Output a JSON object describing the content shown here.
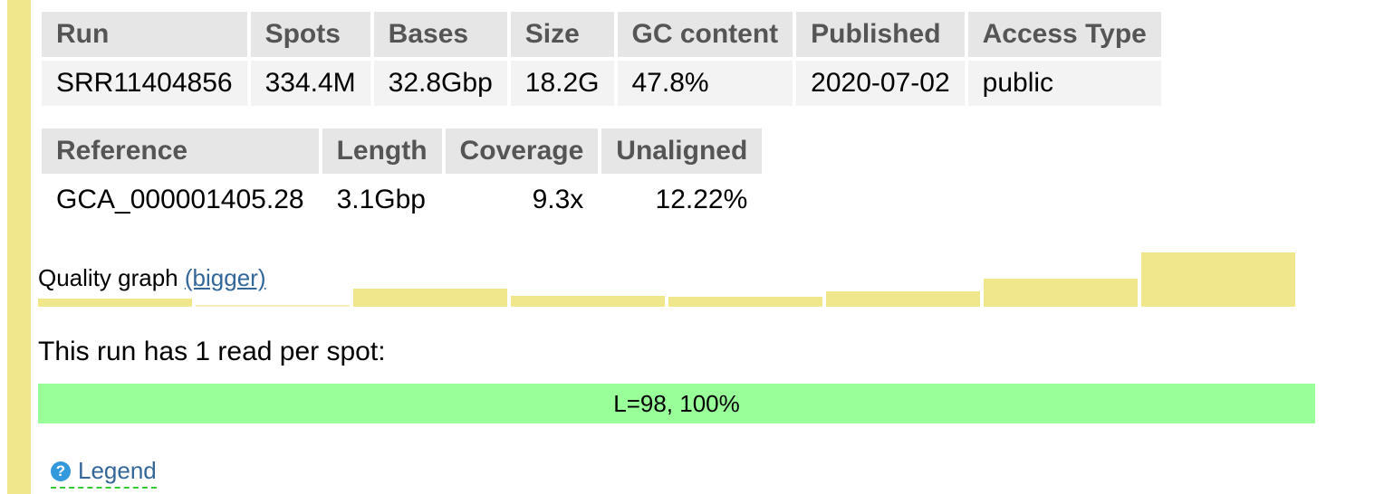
{
  "run_table": {
    "headers": [
      "Run",
      "Spots",
      "Bases",
      "Size",
      "GC content",
      "Published",
      "Access Type"
    ],
    "row": [
      "SRR11404856",
      "334.4M",
      "32.8Gbp",
      "18.2G",
      "47.8%",
      "2020-07-02",
      "public"
    ]
  },
  "reference_table": {
    "headers": [
      "Reference",
      "Length",
      "Coverage",
      "Unaligned"
    ],
    "row": [
      "GCA_000001405.28",
      "3.1Gbp",
      "9.3x",
      "12.22%"
    ]
  },
  "quality_graph": {
    "label": "Quality graph",
    "link": "(bigger)",
    "bar_levels": [
      0.15,
      0.03,
      0.33,
      0.2,
      0.18,
      0.28,
      0.52,
      1.0
    ],
    "bar_color": "#f0e68c"
  },
  "reads": {
    "summary": "This run has 1 read per spot:",
    "bar_label": "L=98, 100%",
    "bar_color": "#99ff99"
  },
  "legend": {
    "icon": "help-icon",
    "label": "Legend"
  }
}
